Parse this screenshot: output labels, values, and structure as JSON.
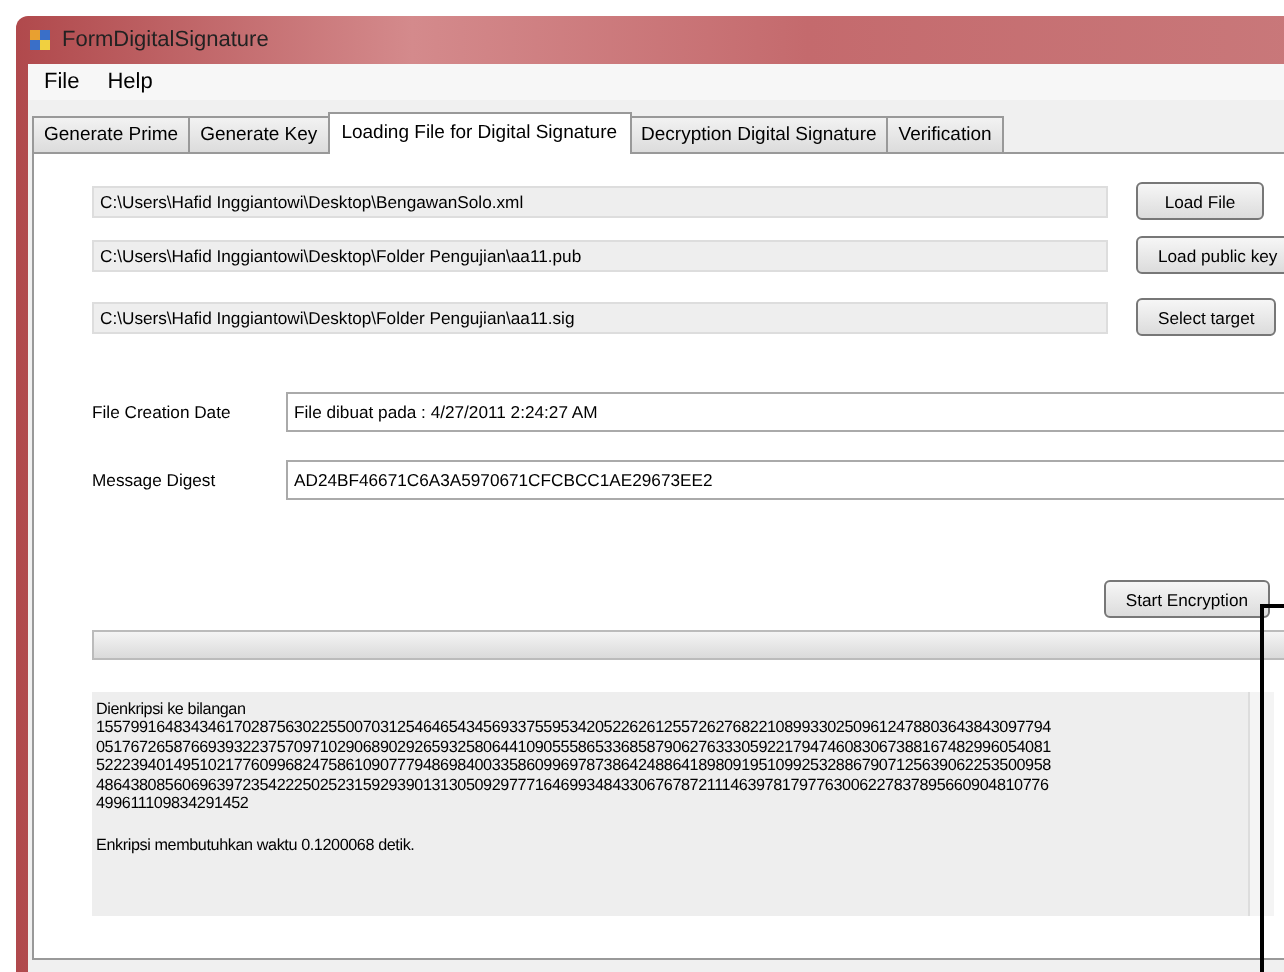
{
  "window": {
    "title": "FormDigitalSignature"
  },
  "menu": [
    "File",
    "Help"
  ],
  "tabs": [
    {
      "label": "Generate Prime",
      "selected": false
    },
    {
      "label": "Generate Key",
      "selected": false
    },
    {
      "label": "Loading File for Digital Signature",
      "selected": true
    },
    {
      "label": "Decryption Digital Signature",
      "selected": false
    },
    {
      "label": "Verification",
      "selected": false
    }
  ],
  "files": [
    {
      "path": "C:\\Users\\Hafid Inggiantowi\\Desktop\\BengawanSolo.xml",
      "button": "Load File"
    },
    {
      "path": "C:\\Users\\Hafid Inggiantowi\\Desktop\\Folder Pengujian\\aa11.pub",
      "button": "Load public key"
    },
    {
      "path": "C:\\Users\\Hafid Inggiantowi\\Desktop\\Folder Pengujian\\aa11.sig",
      "button": "Select target"
    }
  ],
  "info": [
    {
      "label": "File Creation Date",
      "value": "File dibuat pada : 4/27/2011 2:24:27 AM"
    },
    {
      "label": "Message Digest",
      "value": "AD24BF46671C6A3A5970671CFCBCC1AE29673EE2"
    }
  ],
  "start_button": "Start Encryption",
  "progress": {
    "level": 0
  },
  "output": {
    "lines": [
      "Dienkripsi ke bilangan",
      "155799164834346170287563022550070312546465434569337559534205226261255726276822108993302509612478803643843097794",
      "051767265876693932237570971029068902926593258064410905558653368587906276333059221794746083067388167482996054081",
      "522239401495102177609968247586109077794869840033586099697873864248864189809195109925328867907125639062253500958",
      "486438085606963972354222502523159293901313050929777164699348433067678721114639781797763006227837895660904810776",
      "499611109834291452"
    ],
    "summary": "Enkripsi membutuhkan waktu 0.1200068 detik."
  }
}
